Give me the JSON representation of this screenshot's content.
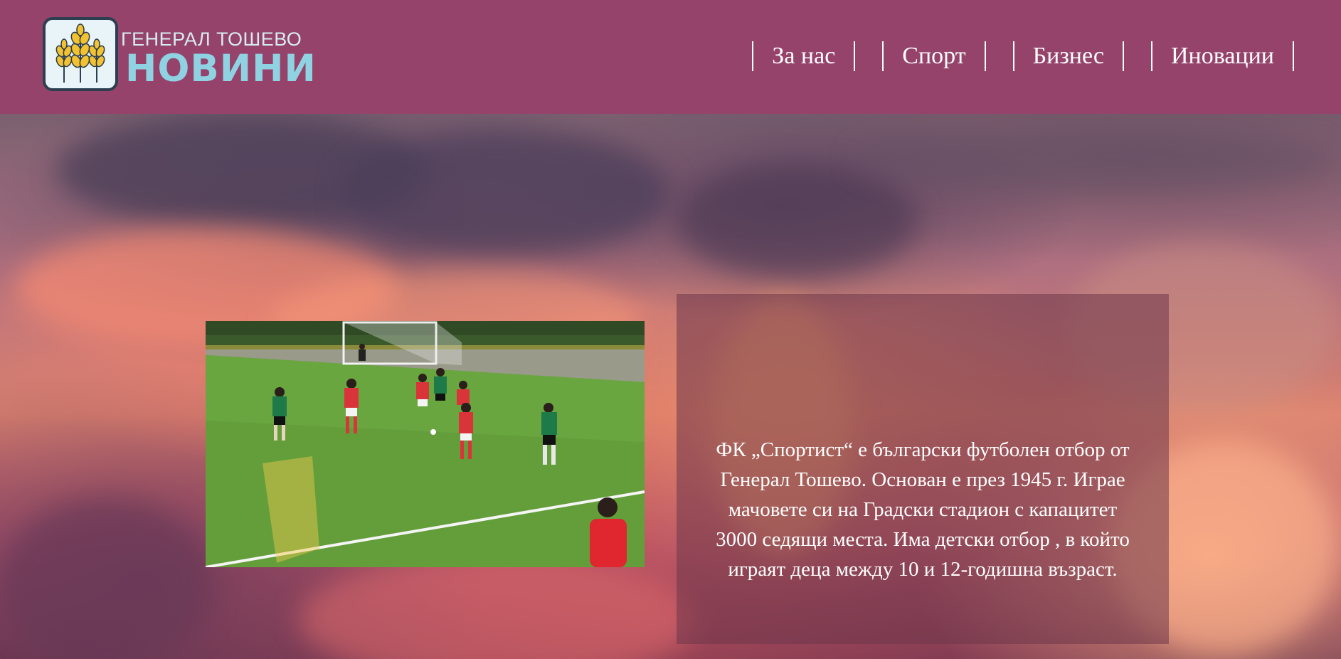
{
  "logo": {
    "line1": "ГЕНЕРАЛ ТОШЕВО",
    "line2": "НОВИНИ",
    "icon": "wheat-icon"
  },
  "nav": {
    "items": [
      {
        "label": "За нас"
      },
      {
        "label": "Спорт"
      },
      {
        "label": "Бизнес"
      },
      {
        "label": "Иновации"
      }
    ]
  },
  "hero": {
    "photo": {
      "description_icon": "football-match-photo"
    },
    "info_text": "ФК „Спортист“ е български футболен отбор от Генерал Тошево. Основан е през 1945 г. Играе мачовете си на Градски стадион с капацитет 3000 седящи места. Има детски отбор , в който играят деца между 10 и 12-годишна възраст."
  },
  "colors": {
    "header_bg": "#96436c",
    "logo_text_light": "#d6ecf1",
    "logo_text_accent": "#8fd3e3",
    "nav_text": "#ffffff",
    "card_bg": "rgba(110,55,75,0.55)"
  }
}
